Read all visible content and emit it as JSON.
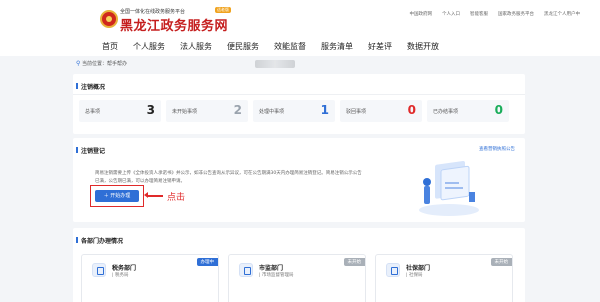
{
  "header": {
    "brand_top": "全国一体化在线政务服务平台",
    "brand_tag": "适老版",
    "brand_main": "黑龙江政务服务网",
    "top_links": [
      "中国政府网",
      "个人入口",
      "智能客服",
      "国家政务服务平台",
      "黑龙江个人用户中"
    ]
  },
  "nav": {
    "items": [
      "首页",
      "个人服务",
      "法人服务",
      "便民服务",
      "效能监督",
      "服务清单",
      "好差评",
      "数据开放"
    ]
  },
  "breadcrumb": {
    "prefix": "当前位置：",
    "current": "帮手帮办"
  },
  "overview": {
    "title": "注销概况",
    "stats": [
      {
        "label": "总事项",
        "value": "3",
        "color": "#222222"
      },
      {
        "label": "未开始事项",
        "value": "2",
        "color": "#9aa3ad"
      },
      {
        "label": "处理中事项",
        "value": "1",
        "color": "#2f6fd6"
      },
      {
        "label": "驳回事项",
        "value": "0",
        "color": "#e02a2a"
      },
      {
        "label": "已办结事项",
        "value": "0",
        "color": "#1aad5a"
      }
    ]
  },
  "register": {
    "title": "注销登记",
    "link": "查看营销执照公告",
    "text": "简易注销需要上传《全体投资人承诺书》并公示，如非公告查询从示异议，可在公告期满30天内办理简易注销登记。简易注销公示公告已满，公告期已满，可以办理简易注销申请。",
    "button": "＋ 开始办理",
    "annotation": "点击"
  },
  "departments": {
    "title": "各部门办理情况",
    "items": [
      {
        "name": "税务部门",
        "sub": "税务局",
        "status": "办理中",
        "status_color": "#2f6fd6"
      },
      {
        "name": "市监部门",
        "sub": "市场监督管理局",
        "status": "未开始",
        "status_color": "#a9b0b8"
      },
      {
        "name": "社保部门",
        "sub": "社保局",
        "status": "未开始",
        "status_color": "#a9b0b8"
      }
    ]
  }
}
